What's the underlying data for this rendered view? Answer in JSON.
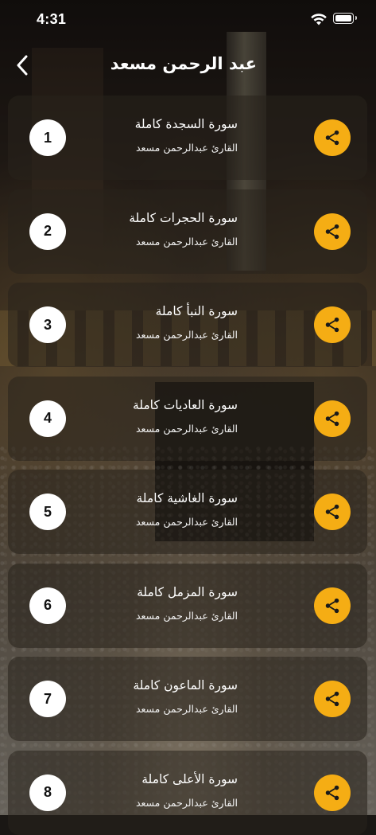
{
  "status_bar": {
    "time": "4:31"
  },
  "header": {
    "title": "عبد الرحمن مسعد"
  },
  "colors": {
    "accent": "#f5ad14",
    "number_bg": "#ffffff"
  },
  "items": [
    {
      "number": "1",
      "title": "سورة السجدة كاملة",
      "reader": "القارئ عبدالرحمن مسعد"
    },
    {
      "number": "2",
      "title": "سورة الحجرات كاملة",
      "reader": "القارئ عبدالرحمن مسعد"
    },
    {
      "number": "3",
      "title": "سورة النبأ كاملة",
      "reader": "القارئ عبدالرحمن مسعد"
    },
    {
      "number": "4",
      "title": "سورة العاديات كاملة",
      "reader": "القارئ عبدالرحمن مسعد"
    },
    {
      "number": "5",
      "title": "سورة الغاشية كاملة",
      "reader": "القارئ عبدالرحمن مسعد"
    },
    {
      "number": "6",
      "title": "سورة المزمل كاملة",
      "reader": "القارئ عبدالرحمن مسعد"
    },
    {
      "number": "7",
      "title": "سورة الماعون كاملة",
      "reader": "القارئ عبدالرحمن مسعد"
    },
    {
      "number": "8",
      "title": "سورة الأعلى كاملة",
      "reader": "القارئ عبدالرحمن مسعد"
    }
  ],
  "icons": {
    "back": "chevron-left-icon",
    "share": "share-icon",
    "wifi": "wifi-icon",
    "battery": "battery-icon"
  }
}
